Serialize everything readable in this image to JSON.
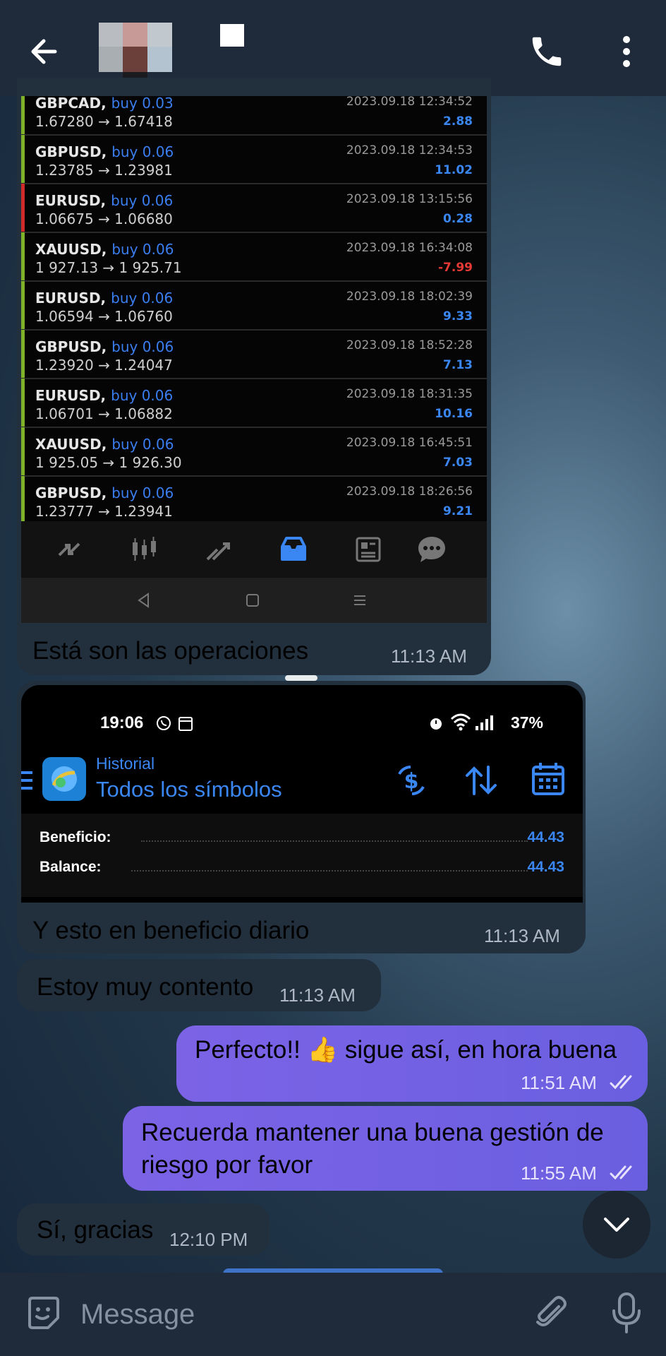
{
  "header": {
    "back_icon": "arrow-left-icon",
    "call_icon": "phone-icon",
    "menu_icon": "more-vertical-icon"
  },
  "trades": [
    {
      "symbol": "GBPCAD,",
      "direction": "buy 0.03",
      "prices": "1.67280 → 1.67418",
      "date": "2023.09.18 12:34:52",
      "profit": "2.88",
      "color": "#7fb228"
    },
    {
      "symbol": "GBPUSD,",
      "direction": "buy 0.06",
      "prices": "1.23785 → 1.23981",
      "date": "2023.09.18 12:34:53",
      "profit": "11.02",
      "color": "#7fb228"
    },
    {
      "symbol": "EURUSD,",
      "direction": "buy 0.06",
      "prices": "1.06675 → 1.06680",
      "date": "2023.09.18 13:15:56",
      "profit": "0.28",
      "color": "#d12a2a"
    },
    {
      "symbol": "XAUUSD,",
      "direction": "buy 0.06",
      "prices": "1 927.13 → 1 925.71",
      "date": "2023.09.18 16:34:08",
      "profit": "-7.99",
      "color": "#7fb228"
    },
    {
      "symbol": "EURUSD,",
      "direction": "buy 0.06",
      "prices": "1.06594 → 1.06760",
      "date": "2023.09.18 18:02:39",
      "profit": "9.33",
      "color": "#7fb228"
    },
    {
      "symbol": "GBPUSD,",
      "direction": "buy 0.06",
      "prices": "1.23920 → 1.24047",
      "date": "2023.09.18 18:52:28",
      "profit": "7.13",
      "color": "#7fb228"
    },
    {
      "symbol": "EURUSD,",
      "direction": "buy 0.06",
      "prices": "1.06701 → 1.06882",
      "date": "2023.09.18 18:31:35",
      "profit": "10.16",
      "color": "#7fb228"
    },
    {
      "symbol": "XAUUSD,",
      "direction": "buy 0.06",
      "prices": "1 925.05 → 1 926.30",
      "date": "2023.09.18 16:45:51",
      "profit": "7.03",
      "color": "#7fb228"
    },
    {
      "symbol": "GBPUSD,",
      "direction": "buy 0.06",
      "prices": "1.23777 → 1.23941",
      "date": "2023.09.18 18:26:56",
      "profit": "9.21",
      "color": "#7fb228"
    }
  ],
  "colors": {
    "profit_positive": "#3a86f2",
    "profit_negative": "#e53935",
    "outgoing_bubble": "#7362e4",
    "incoming_bubble": "#222f3d"
  },
  "toolbar_icons": [
    "quotes-icon",
    "chart-candles-icon",
    "trade-icon",
    "history-icon",
    "news-icon",
    "chat-icon"
  ],
  "messages": {
    "m1": {
      "text": "Está son las operaciones",
      "time": "11:13 AM"
    },
    "m2": {
      "text": "Y esto en beneficio diario",
      "time": "11:13 AM"
    },
    "m3": {
      "text": "Estoy muy contento",
      "time": "11:13 AM"
    },
    "m4": {
      "text": "Perfecto!! 👍 sigue así, en hora buena",
      "time": "11:51 AM"
    },
    "m5": {
      "line1": "Recuerda mantener una buena gestión de",
      "line2": "riesgo por favor",
      "time": "11:55 AM"
    },
    "m6": {
      "text": "Sí, gracias",
      "time": "12:10 PM"
    }
  },
  "history_screen": {
    "status_time": "19:06",
    "battery": "37%",
    "subtitle": "Historial",
    "title": "Todos los símbolos",
    "beneficio_label": "Beneficio:",
    "beneficio_value": "44.43",
    "balance_label": "Balance:",
    "balance_value": "44.43"
  },
  "composer": {
    "placeholder": "Message"
  }
}
